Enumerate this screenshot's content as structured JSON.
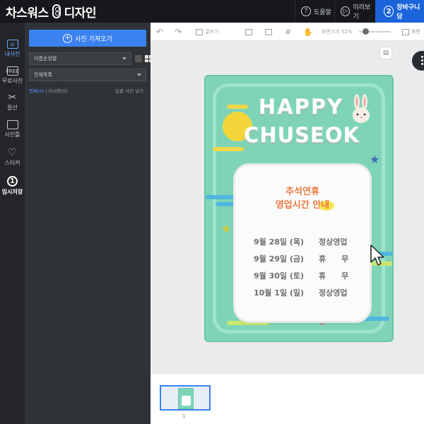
{
  "topbar": {
    "logo_left": "차스워스",
    "logo_right": "디자인",
    "help": "도움말",
    "preview": "미리보기",
    "cart_num": "2",
    "cart": "장바구니 담"
  },
  "rail": {
    "items": [
      {
        "label": "내사진",
        "active": true
      },
      {
        "label": "무료사진"
      },
      {
        "label": "칼선"
      },
      {
        "label": "사진틀"
      },
      {
        "label": "스티커"
      },
      {
        "label": "임시저장"
      }
    ],
    "free_badge": "FREE",
    "temp_num": "1"
  },
  "panel": {
    "import_button": "사진 가져오기",
    "sort_select": "이름순정렬",
    "list_select": "전체목록",
    "filter_all": "전체(0)",
    "filter_unused": "미사용(0)",
    "bulk_add": "일괄 사진 넣기"
  },
  "toolbar": {
    "text_tool": "글쓰기",
    "zoom_label": "화면크기 52%",
    "fit_label": "화면"
  },
  "poster": {
    "line1": "HAPPY",
    "line2": "CHUSEOK",
    "title_a": "추석연휴",
    "title_b": "영업시간 안내",
    "rows": [
      {
        "date": "9월 28일 (목)",
        "status": "정상영업"
      },
      {
        "date": "9월 29일 (금)",
        "status": "휴　　무"
      },
      {
        "date": "9월 30일 (토)",
        "status": "휴　　무"
      },
      {
        "date": "10월 1일 (일)",
        "status": "정상영업"
      }
    ]
  },
  "pages": {
    "current": "1"
  },
  "colors": {
    "accent": "#3b82f0",
    "cart": "#1b64da",
    "poster_bg": "#7fd4b8",
    "title": "#ee7a3e"
  }
}
